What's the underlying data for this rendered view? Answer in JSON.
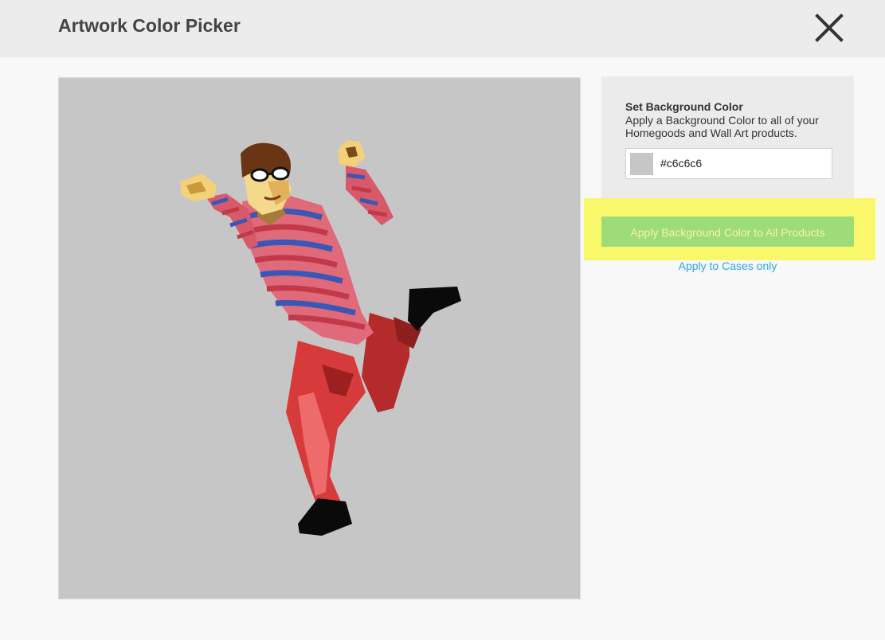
{
  "header": {
    "title": "Artwork Color Picker",
    "close_icon": "close-x-icon"
  },
  "preview": {
    "background_color": "#c6c6c6",
    "artwork": "dancing-man-illustration"
  },
  "panel": {
    "heading": "Set Background Color",
    "description": "Apply a Background Color to all of your Homegoods and Wall Art products.",
    "color_value": "#c6c6c6",
    "swatch_color": "#c6c6c6"
  },
  "actions": {
    "apply_all_label": "Apply Background Color to All Products",
    "apply_cases_label": "Apply to Cases only"
  },
  "colors": {
    "accent_green": "#9edc79",
    "link_blue": "#2aa6e0",
    "highlight_yellow": "#f9f86a"
  }
}
